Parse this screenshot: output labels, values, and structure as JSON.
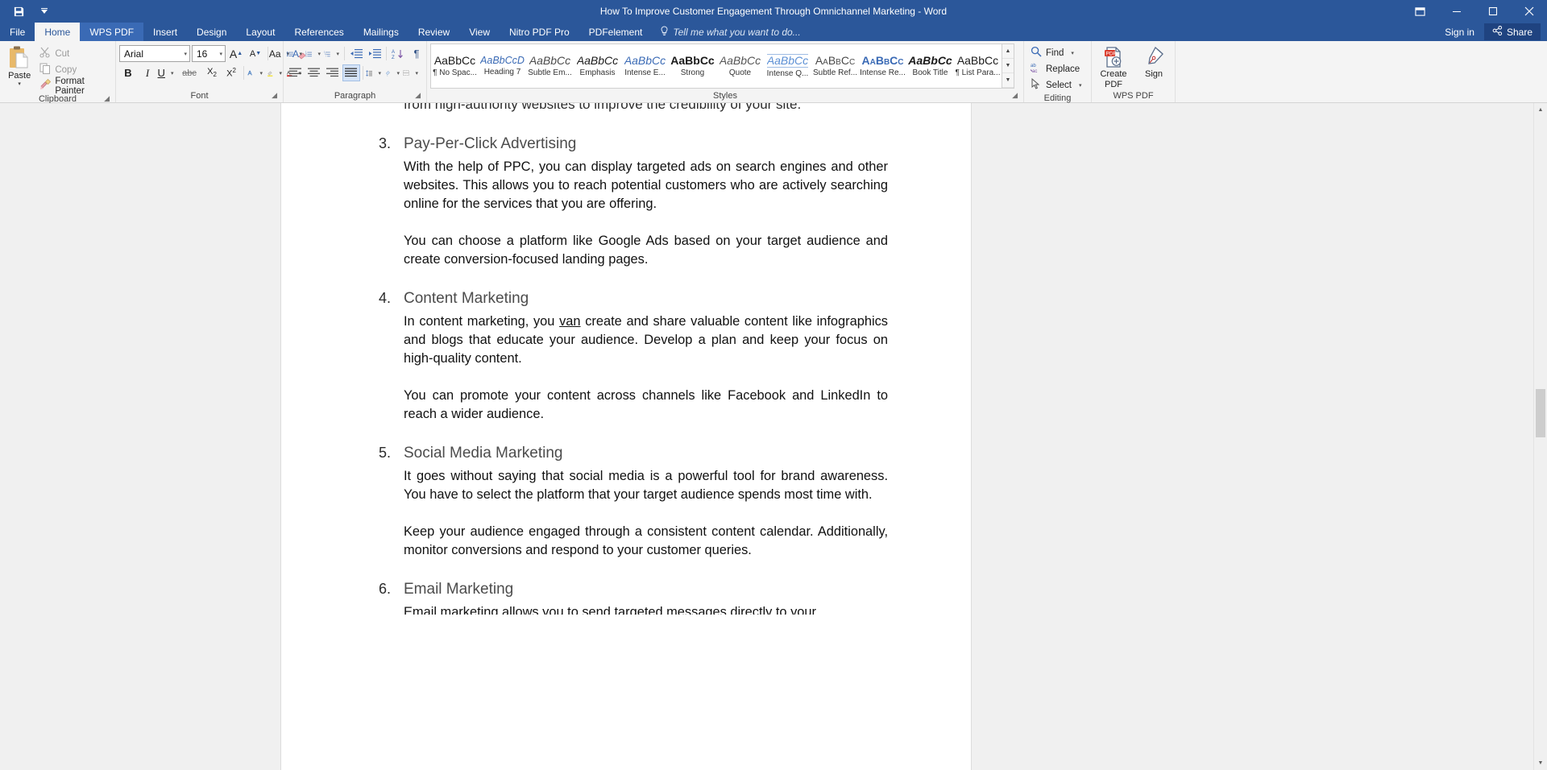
{
  "window": {
    "title": "How To Improve Customer Engagement Through Omnichannel Marketing - Word",
    "quick_access": [
      {
        "name": "save-icon",
        "glyph": "💾"
      },
      {
        "name": "customize-qat-icon",
        "glyph": "▾"
      }
    ],
    "controls": {
      "ribbon_display_options": "▣",
      "minimize": "─",
      "maximize": "☐",
      "close": "✕"
    }
  },
  "tabs": [
    {
      "label": "File",
      "state": "file"
    },
    {
      "label": "Home",
      "state": "active"
    },
    {
      "label": "WPS PDF",
      "state": "wps"
    },
    {
      "label": "Insert",
      "state": "normal"
    },
    {
      "label": "Design",
      "state": "normal"
    },
    {
      "label": "Layout",
      "state": "normal"
    },
    {
      "label": "References",
      "state": "normal"
    },
    {
      "label": "Mailings",
      "state": "normal"
    },
    {
      "label": "Review",
      "state": "normal"
    },
    {
      "label": "View",
      "state": "normal"
    },
    {
      "label": "Nitro PDF Pro",
      "state": "normal"
    },
    {
      "label": "PDFelement",
      "state": "normal"
    }
  ],
  "tell_me": {
    "icon": "lightbulb-icon",
    "text": "Tell me what you want to do..."
  },
  "account": {
    "sign_in": "Sign in",
    "share": "Share"
  },
  "ribbon": {
    "clipboard": {
      "label": "Clipboard",
      "paste": "Paste",
      "commands": [
        {
          "label": "Cut",
          "icon": "scissors-icon",
          "enabled": false
        },
        {
          "label": "Copy",
          "icon": "copy-icon",
          "enabled": false
        },
        {
          "label": "Format Painter",
          "icon": "format-painter-icon",
          "enabled": true
        }
      ]
    },
    "font": {
      "label": "Font",
      "font_name": "Arial",
      "font_size": "16",
      "grow_font": "A",
      "shrink_font": "A",
      "change_case": "Aa",
      "clear_formatting": "clear-formatting-icon",
      "bold": "B",
      "italic": "I",
      "underline": "U",
      "strikethrough": "abc",
      "subscript": "X₂",
      "superscript": "X²",
      "text_effects": "A",
      "highlight": "ab",
      "font_color": "A"
    },
    "paragraph": {
      "label": "Paragraph",
      "bullets": "bullets-icon",
      "numbering": "numbering-icon",
      "multilevel": "multilevel-list-icon",
      "decrease_indent": "decrease-indent-icon",
      "increase_indent": "increase-indent-icon",
      "sort": "sort-icon",
      "show_marks": "¶",
      "align_left": "align-left-icon",
      "align_center": "align-center-icon",
      "align_right": "align-right-icon",
      "justify": "justify-icon",
      "line_spacing": "line-spacing-icon",
      "shading": "shading-icon",
      "borders": "borders-icon"
    },
    "styles": {
      "label": "Styles",
      "items": [
        {
          "preview": "AaBbCc",
          "name": "¶ No Spac...",
          "style": "normal"
        },
        {
          "preview": "AaBbCcD",
          "name": "Heading 7",
          "style": "blue-italic-small"
        },
        {
          "preview": "AaBbCc",
          "name": "Subtle Em...",
          "style": "italic"
        },
        {
          "preview": "AaBbCc",
          "name": "Emphasis",
          "style": "italic"
        },
        {
          "preview": "AaBbCc",
          "name": "Intense E...",
          "style": "italic"
        },
        {
          "preview": "AaBbCc",
          "name": "Strong",
          "style": "bold"
        },
        {
          "preview": "AaBbCc",
          "name": "Quote",
          "style": "italic"
        },
        {
          "preview": "AaBbCc",
          "name": "Intense Q...",
          "style": "blue-italic-underline"
        },
        {
          "preview": "AaBbCc",
          "name": "Subtle Ref...",
          "style": "smallcaps"
        },
        {
          "preview": "AaBbCc",
          "name": "Intense Re...",
          "style": "blue-smallcaps"
        },
        {
          "preview": "AaBbCc",
          "name": "Book Title",
          "style": "bold-italic"
        },
        {
          "preview": "AaBbCc",
          "name": "¶ List Para...",
          "style": "normal"
        }
      ]
    },
    "editing": {
      "label": "Editing",
      "commands": [
        {
          "label": "Find",
          "icon": "magnifier-icon",
          "has_caret": true
        },
        {
          "label": "Replace",
          "icon": "replace-icon",
          "has_caret": false
        },
        {
          "label": "Select",
          "icon": "cursor-select-icon",
          "has_caret": true
        }
      ]
    },
    "wps_pdf": {
      "label": "WPS PDF",
      "commands": [
        {
          "label": "Create PDF",
          "icon": "create-pdf-icon"
        },
        {
          "label": "Sign",
          "icon": "sign-pen-icon"
        }
      ]
    }
  },
  "document": {
    "clipped_top_line": "from high-authority websites to improve the credibility of your site.",
    "sections": [
      {
        "number": "3.",
        "heading": "Pay-Per-Click Advertising",
        "paragraphs": [
          "With the help of PPC, you can display targeted ads on search engines and other websites. This allows you to reach potential customers who are actively searching online for the services that you are offering.",
          "You can choose a platform like Google Ads based on your target audience and create conversion-focused landing pages."
        ]
      },
      {
        "number": "4.",
        "heading": "Content Marketing",
        "paragraphs": [
          "In content marketing, you van create and share valuable content like infographics and blogs that educate your audience. Develop a plan and keep your focus on high-quality content.",
          "You can promote your content across channels like Facebook and LinkedIn to reach a wider audience."
        ],
        "misspelled_word": "van"
      },
      {
        "number": "5.",
        "heading": "Social Media Marketing",
        "paragraphs": [
          "It goes without saying that social media is a powerful tool for brand awareness. You have to select the platform that your target audience spends most time with.",
          "Keep your audience engaged through a consistent content calendar. Additionally, monitor conversions and respond to your customer queries."
        ]
      },
      {
        "number": "6.",
        "heading": "Email Marketing",
        "paragraphs": [
          "Email marketing allows you to send targeted messages directly to your"
        ]
      }
    ]
  },
  "scrollbar": {
    "up_arrow": "▲",
    "down_arrow": "▼"
  },
  "colors": {
    "word_blue": "#2b579a",
    "ribbon_bg": "#f4f4f4",
    "accent_blue": "#2b579a",
    "page_white": "#ffffff",
    "app_bg": "#f0f0f0"
  }
}
